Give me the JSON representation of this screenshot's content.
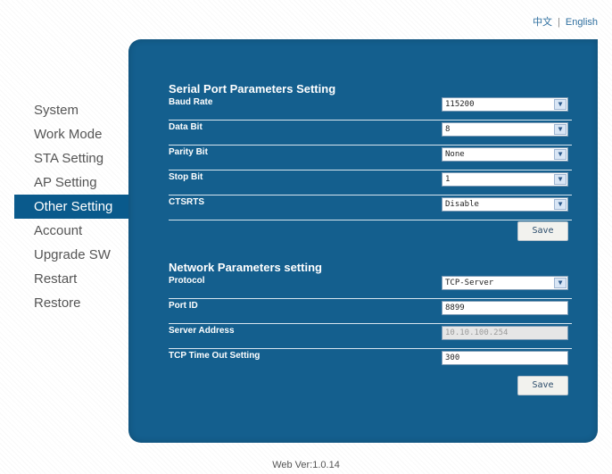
{
  "header": {
    "lang_cn": "中文",
    "lang_sep": "|",
    "lang_en": "English"
  },
  "sidebar": {
    "items": [
      {
        "label": "System",
        "active": false
      },
      {
        "label": "Work Mode",
        "active": false
      },
      {
        "label": "STA Setting",
        "active": false
      },
      {
        "label": "AP Setting",
        "active": false
      },
      {
        "label": "Other Setting",
        "active": true
      },
      {
        "label": "Account",
        "active": false
      },
      {
        "label": "Upgrade SW",
        "active": false
      },
      {
        "label": "Restart",
        "active": false
      },
      {
        "label": "Restore",
        "active": false
      }
    ]
  },
  "serial": {
    "title": "Serial Port Parameters Setting",
    "baud_rate": {
      "label": "Baud Rate",
      "value": "115200"
    },
    "data_bit": {
      "label": "Data Bit",
      "value": "8"
    },
    "parity_bit": {
      "label": "Parity Bit",
      "value": "None"
    },
    "stop_bit": {
      "label": "Stop Bit",
      "value": "1"
    },
    "ctsrts": {
      "label": "CTSRTS",
      "value": "Disable"
    },
    "save_label": "Save"
  },
  "network": {
    "title": "Network Parameters setting",
    "protocol": {
      "label": "Protocol",
      "value": "TCP-Server"
    },
    "port_id": {
      "label": "Port ID",
      "value": "8899"
    },
    "server_address": {
      "label": "Server Address",
      "value": "10.10.100.254"
    },
    "tcp_timeout": {
      "label": "TCP Time Out Setting",
      "value": "300"
    },
    "save_label": "Save"
  },
  "footer": {
    "version": "Web Ver:1.0.14"
  },
  "colors": {
    "panel_bg": "#145f8e",
    "active_nav": "#0a5a8c",
    "nav_text": "#555555"
  }
}
